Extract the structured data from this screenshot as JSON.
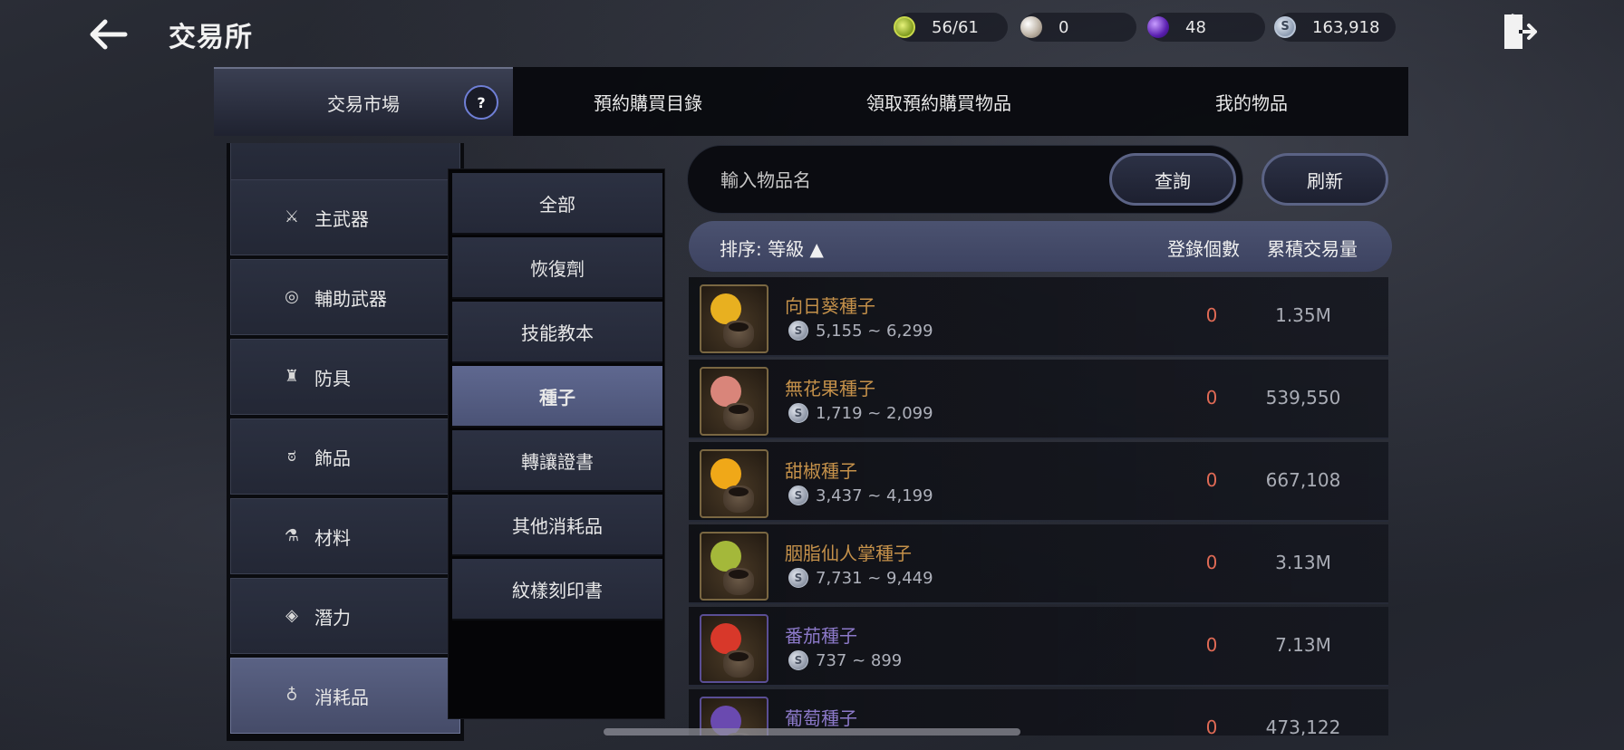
{
  "header": {
    "title": "交易所",
    "currencies": [
      {
        "name": "energy",
        "value": "56/61",
        "icon": "energy-icon"
      },
      {
        "name": "pearl",
        "value": "0",
        "icon": "pearl-icon"
      },
      {
        "name": "orb",
        "value": "48",
        "icon": "purple-orb-icon"
      },
      {
        "name": "silver",
        "value": "163,918",
        "icon": "silver-coin-icon",
        "symbol": "S"
      }
    ]
  },
  "tabs": [
    {
      "label": "交易市場",
      "active": true
    },
    {
      "label": "預約購買目錄",
      "active": false
    },
    {
      "label": "領取預約購買物品",
      "active": false
    },
    {
      "label": "我的物品",
      "active": false
    }
  ],
  "categories": [
    {
      "label": "",
      "icon": "partial-item-icon"
    },
    {
      "label": "主武器",
      "icon": "crossed-swords-icon"
    },
    {
      "label": "輔助武器",
      "icon": "target-ring-icon"
    },
    {
      "label": "防具",
      "icon": "armor-icon"
    },
    {
      "label": "飾品",
      "icon": "ring-icon"
    },
    {
      "label": "材料",
      "icon": "flask-icon"
    },
    {
      "label": "潛力",
      "icon": "diamond-icon"
    },
    {
      "label": "消耗品",
      "icon": "potion-icon",
      "active": true
    }
  ],
  "subcategories": [
    {
      "label": "全部"
    },
    {
      "label": "恢復劑"
    },
    {
      "label": "技能教本"
    },
    {
      "label": "種子",
      "active": true
    },
    {
      "label": "轉讓證書"
    },
    {
      "label": "其他消耗品"
    },
    {
      "label": "紋樣刻印書"
    }
  ],
  "search": {
    "placeholder": "輸入物品名",
    "query_label": "查詢",
    "refresh_label": "刷新"
  },
  "table": {
    "sort_label": "排序: 等級 ▲",
    "col_count": "登錄個數",
    "col_volume": "累積交易量",
    "rows": [
      {
        "name": "向日葵種子",
        "price": "5,155 ~ 6,299",
        "count": "0",
        "volume": "1.35M",
        "grade": "normal",
        "fruit_color": "#e8b020"
      },
      {
        "name": "無花果種子",
        "price": "1,719 ~ 2,099",
        "count": "0",
        "volume": "539,550",
        "grade": "normal",
        "fruit_color": "#d9857a"
      },
      {
        "name": "甜椒種子",
        "price": "3,437 ~ 4,199",
        "count": "0",
        "volume": "667,108",
        "grade": "normal",
        "fruit_color": "#f0a818"
      },
      {
        "name": "胭脂仙人掌種子",
        "price": "7,731 ~ 9,449",
        "count": "0",
        "volume": "3.13M",
        "grade": "normal",
        "fruit_color": "#a4b83a"
      },
      {
        "name": "番茄種子",
        "price": "737 ~ 899",
        "count": "0",
        "volume": "7.13M",
        "grade": "epic",
        "fruit_color": "#d8382a"
      },
      {
        "name": "葡萄種子",
        "price": "",
        "count": "0",
        "volume": "473,122",
        "grade": "epic",
        "fruit_color": "#6a4ab0"
      }
    ]
  },
  "colors": {
    "accent": "#5b6385",
    "item_name_normal": "#c5914a",
    "item_name_epic": "#8c79c9",
    "count_red": "#e06a55"
  }
}
